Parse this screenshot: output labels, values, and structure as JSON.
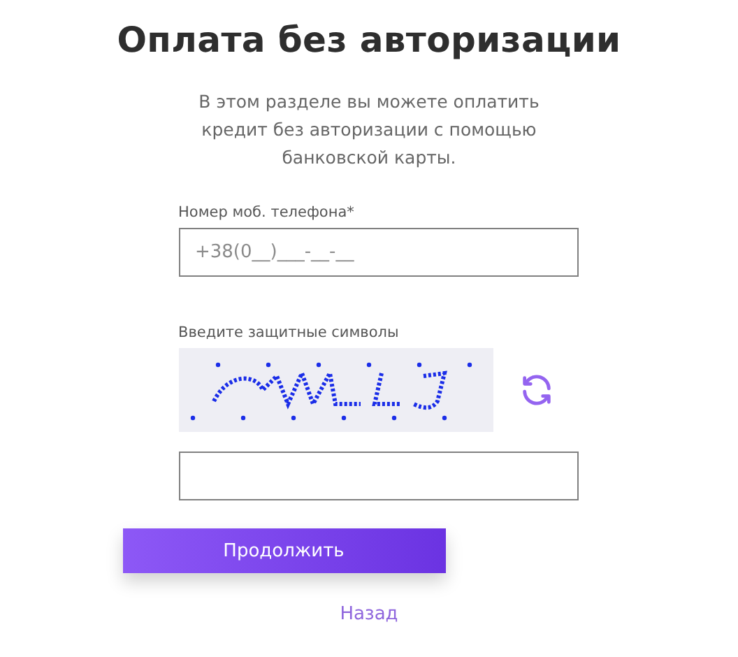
{
  "title": "Оплата без авторизации",
  "description": "В этом разделе вы можете оплатить кредит без авторизации с помощью банковской карты.",
  "phone_field": {
    "label": "Номер моб. телефона*",
    "placeholder": "+38(0__)___-__-__"
  },
  "captcha": {
    "label": "Введите защитные символы",
    "kind": "picture"
  },
  "submit_button": "Продолжить",
  "back_link": "Назад"
}
